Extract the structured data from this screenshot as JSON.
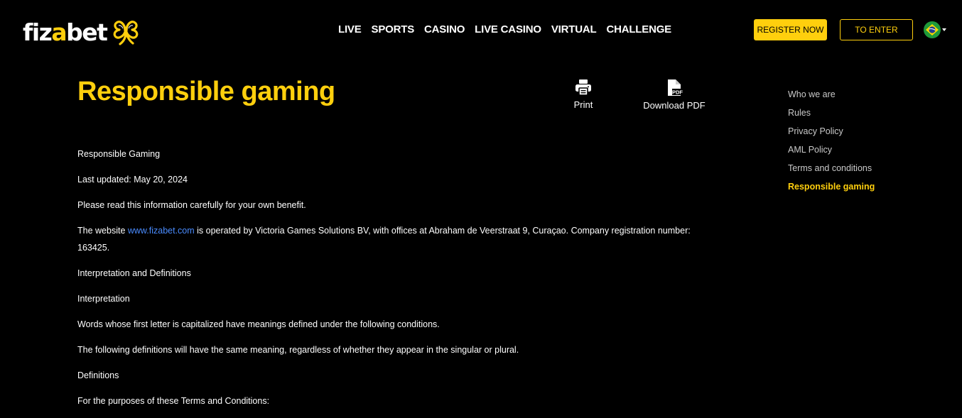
{
  "brand": {
    "logo_part1": "fiz",
    "logo_part2": "a",
    "logo_part3": "bet",
    "accent_color": "#ffcf0d",
    "link_color": "#4a8cff",
    "background_color": "#000000"
  },
  "nav": {
    "items": [
      "LIVE",
      "SPORTS",
      "CASINO",
      "LIVE CASINO",
      "VIRTUAL",
      "CHALLENGE"
    ]
  },
  "header": {
    "register_label": "REGISTER NOW",
    "enter_label": "TO ENTER",
    "language_icon": "brazil-flag-icon"
  },
  "page": {
    "title": "Responsible gaming",
    "print_label": "Print",
    "download_label": "Download PDF",
    "pdf_icon_text": "PDF"
  },
  "content": {
    "heading": "Responsible Gaming",
    "last_updated": "Last updated: May 20, 2024",
    "intro": "Please read this information carefully for your own benefit.",
    "operator_prefix": "The website ",
    "operator_link": "www.fizabet.com",
    "operator_suffix": " is operated by Victoria Games Solutions BV, with offices at Abraham de Veerstraat 9, Curaçao. Company registration number: 163425.",
    "interp_defs": "Interpretation and Definitions",
    "interpretation": "Interpretation",
    "words_capitalized": "Words whose first letter is capitalized have meanings defined under the following conditions.",
    "same_meaning": "The following definitions will have the same meaning, regardless of whether they appear in the singular or plural.",
    "definitions": "Definitions",
    "purposes": "For the purposes of these Terms and Conditions:"
  },
  "side_nav": {
    "items": [
      {
        "label": "Who we are",
        "active": false
      },
      {
        "label": "Rules",
        "active": false
      },
      {
        "label": "Privacy Policy",
        "active": false
      },
      {
        "label": "AML Policy",
        "active": false
      },
      {
        "label": "Terms and conditions",
        "active": false
      },
      {
        "label": "Responsible gaming",
        "active": true
      }
    ]
  }
}
